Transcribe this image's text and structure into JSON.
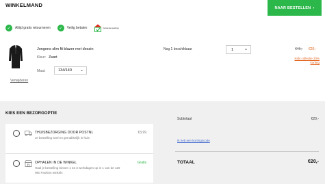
{
  "header": {
    "title": "WINKELMAND",
    "order_button": "NAAR BESTELLEN",
    "order_arrow": "›"
  },
  "usps": [
    {
      "label": "Altijd gratis retourneren",
      "icon": "check-icon"
    },
    {
      "label": "Veilig betalen",
      "icon": "check-icon"
    }
  ],
  "thuiswinkel": {
    "label": "thuiswinkel waarborg",
    "icon": "thuiswinkel-logo"
  },
  "product": {
    "name": "Jongens slim fit blazer met dessin",
    "color_label": "Kleur:",
    "color_value": "Zwart",
    "size_label": "Maat:",
    "size_value": "134/140",
    "remove_label": "Verwijderen",
    "stock": "Nog 1 beschikbaar",
    "quantity": "1",
    "price_old": "€45,-",
    "price_new": "€20,-",
    "promo": "Kids collectie 20% korting"
  },
  "delivery": {
    "title": "KIES EEN BEZORGOPTIE",
    "options": [
      {
        "title": "THUISBEZORGING DOOR POSTNL",
        "desc": "Je bestelling snel en gemakkelijk in huis",
        "price": "€3,99",
        "icon": "truck-icon"
      },
      {
        "title": "OPHALEN IN DE WINKEL",
        "desc": "Haal je bestelling binnen 1 tot 3 werkdagen op in 1 van de 120 WE Fashion winkels",
        "price": "Gratis",
        "icon": "store-icon"
      }
    ]
  },
  "summary": {
    "subtotal_label": "Subtotaal",
    "subtotal_value": "€20,-",
    "code_link": "Ik heb een kortingscode",
    "total_label": "TOTAAL",
    "total_value": "€20,-"
  },
  "colors": {
    "accent": "#2bb74a",
    "sale": "#e3641c",
    "link": "#4a6fd0",
    "panel": "#f0f0f0"
  }
}
